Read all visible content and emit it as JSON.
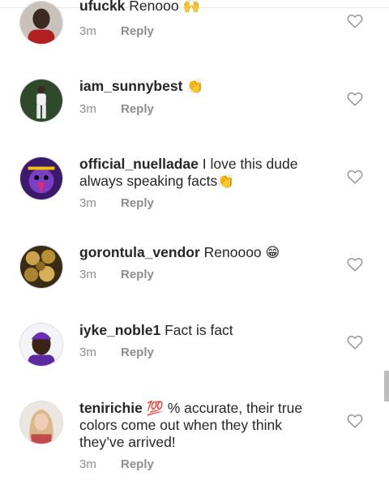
{
  "comments": [
    {
      "username": "ufuckk",
      "text": " Renooo ",
      "emoji": "🙌",
      "time": "3m",
      "reply": "Reply",
      "avatar_icon": "person-avatar-dark"
    },
    {
      "username": "iam_sunnybest",
      "text": " ",
      "emoji": "👏",
      "time": "3m",
      "reply": "Reply",
      "avatar_icon": "person-standing-avatar"
    },
    {
      "username": "official_nuelladae",
      "text": " I love this dude always speaking facts",
      "emoji": "👏",
      "time": "3m",
      "reply": "Reply",
      "avatar_icon": "purple-art-avatar"
    },
    {
      "username": "gorontula_vendor",
      "text": " Renoooo ",
      "emoji": "😁",
      "time": "3m",
      "reply": "Reply",
      "avatar_icon": "gold-balls-avatar"
    },
    {
      "username": "iyke_noble1",
      "text": " Fact is fact",
      "emoji": "",
      "time": "3m",
      "reply": "Reply",
      "avatar_icon": "person-purple-avatar"
    },
    {
      "username": "tenirichie",
      "text": " ",
      "emoji": "💯",
      "text2": " % accurate, their true colors come out when they think they’ve arrived!",
      "time": "3m",
      "reply": "Reply",
      "avatar_icon": "woman-avatar"
    }
  ],
  "colors": {
    "text": "#262626",
    "muted": "#8e8e8e",
    "heart_stroke": "#8e8e8e"
  }
}
